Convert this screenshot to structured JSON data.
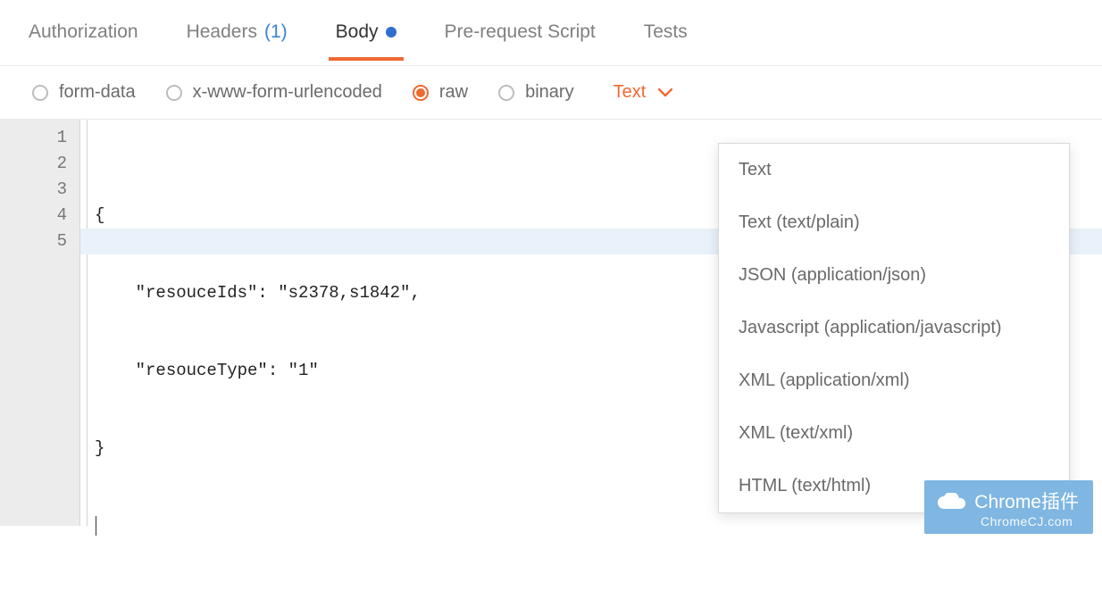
{
  "tabs": {
    "authorization": "Authorization",
    "headers_label": "Headers",
    "headers_count": "(1)",
    "body": "Body",
    "prerequest": "Pre-request Script",
    "tests": "Tests"
  },
  "body_types": {
    "form_data": "form-data",
    "urlencoded": "x-www-form-urlencoded",
    "raw": "raw",
    "binary": "binary"
  },
  "format_trigger": "Text",
  "format_options": [
    "Text",
    "Text (text/plain)",
    "JSON (application/json)",
    "Javascript (application/javascript)",
    "XML (application/xml)",
    "XML (text/xml)",
    "HTML (text/html)"
  ],
  "editor": {
    "line_numbers": [
      "1",
      "2",
      "3",
      "4",
      "5"
    ],
    "lines": [
      "{",
      "    \"resouceIds\": \"s2378,s1842\",",
      "    \"resouceType\": \"1\"",
      "}",
      ""
    ],
    "cursor_line_index": 4
  },
  "watermark": {
    "title": "Chrome插件",
    "sub": "ChromeCJ.com"
  }
}
